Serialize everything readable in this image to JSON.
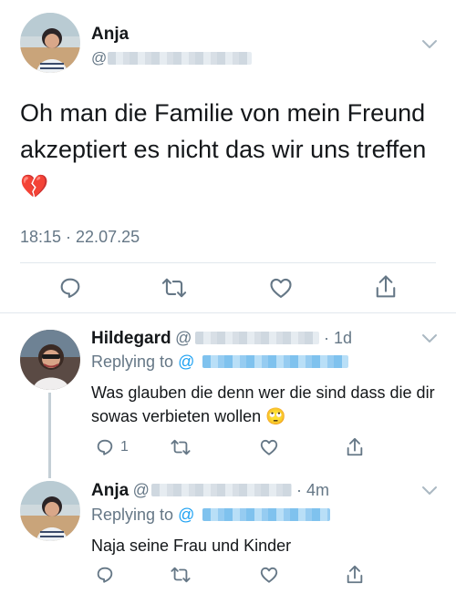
{
  "main_tweet": {
    "author_name": "Anja",
    "handle_prefix": "@",
    "text": "Oh man die Familie von mein Freund akzeptiert es nicht das wir uns treffen",
    "emoji": "💔",
    "timestamp": "18:15 · 22.07.25"
  },
  "replies": [
    {
      "author_name": "Hildegard",
      "handle_prefix": "@",
      "age": "· 1d",
      "replying_to_label": "Replying to",
      "replying_to_prefix": "@",
      "text": "Was glauben die denn wer die sind dass die dir sowas verbieten wollen",
      "emoji": "🙄",
      "reply_count": "1"
    },
    {
      "author_name": "Anja",
      "handle_prefix": "@",
      "age": "· 4m",
      "replying_to_label": "Replying to",
      "replying_to_prefix": "@",
      "text": "Naja seine Frau und Kinder",
      "emoji": "",
      "reply_count": ""
    }
  ],
  "icons": {
    "reply": "reply-icon",
    "retweet": "retweet-icon",
    "like": "heart-icon",
    "share": "share-icon",
    "more": "chevron-down-icon"
  },
  "colors": {
    "text": "#14171a",
    "secondary": "#657786",
    "link": "#1da1f2",
    "divider": "#e1e8ed"
  }
}
